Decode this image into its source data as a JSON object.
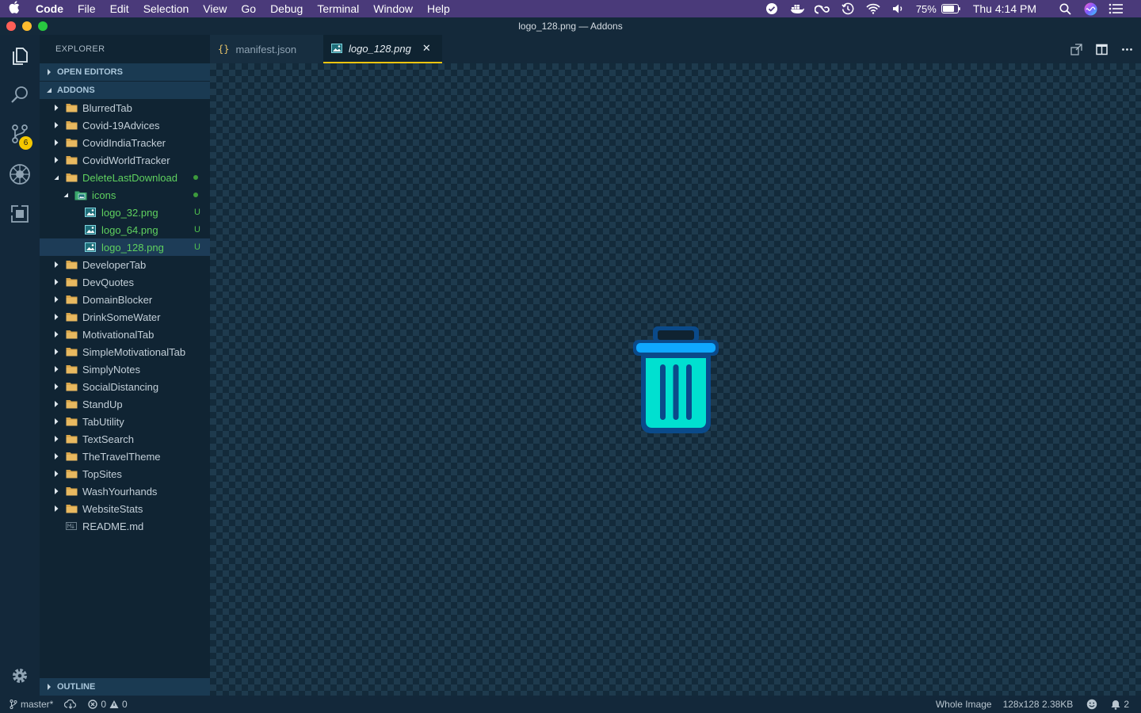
{
  "menubar": {
    "app_name": "Code",
    "items": [
      "File",
      "Edit",
      "Selection",
      "View",
      "Go",
      "Debug",
      "Terminal",
      "Window",
      "Help"
    ],
    "battery_percent": "75%",
    "clock": "Thu 4:14 PM",
    "tray_icons": [
      "reminders-icon",
      "docker-icon",
      "creative-cloud-icon",
      "time-machine-icon",
      "wifi-icon",
      "volume-icon",
      "battery-icon",
      "spotlight-icon",
      "siri-icon",
      "control-list-icon"
    ]
  },
  "window": {
    "title": "logo_128.png — Addons"
  },
  "activitybar": {
    "scm_badge": "6"
  },
  "sidebar": {
    "title": "EXPLORER",
    "open_editors_label": "OPEN EDITORS",
    "root_label": "ADDONS",
    "outline_label": "OUTLINE",
    "tree": [
      {
        "label": "BlurredTab",
        "type": "folder",
        "depth": 0,
        "expanded": false
      },
      {
        "label": "Covid-19Advices",
        "type": "folder",
        "depth": 0,
        "expanded": false
      },
      {
        "label": "CovidIndiaTracker",
        "type": "folder",
        "depth": 0,
        "expanded": false
      },
      {
        "label": "CovidWorldTracker",
        "type": "folder",
        "depth": 0,
        "expanded": false
      },
      {
        "label": "DeleteLastDownload",
        "type": "folder",
        "depth": 0,
        "expanded": true,
        "modified": true
      },
      {
        "label": "icons",
        "type": "folder",
        "depth": 1,
        "expanded": true,
        "modified": true
      },
      {
        "label": "logo_32.png",
        "type": "image",
        "depth": 2,
        "status": "U"
      },
      {
        "label": "logo_64.png",
        "type": "image",
        "depth": 2,
        "status": "U"
      },
      {
        "label": "logo_128.png",
        "type": "image",
        "depth": 2,
        "status": "U",
        "selected": true
      },
      {
        "label": "DeveloperTab",
        "type": "folder",
        "depth": 0,
        "expanded": false
      },
      {
        "label": "DevQuotes",
        "type": "folder",
        "depth": 0,
        "expanded": false
      },
      {
        "label": "DomainBlocker",
        "type": "folder",
        "depth": 0,
        "expanded": false
      },
      {
        "label": "DrinkSomeWater",
        "type": "folder",
        "depth": 0,
        "expanded": false
      },
      {
        "label": "MotivationalTab",
        "type": "folder",
        "depth": 0,
        "expanded": false
      },
      {
        "label": "SimpleMotivationalTab",
        "type": "folder",
        "depth": 0,
        "expanded": false
      },
      {
        "label": "SimplyNotes",
        "type": "folder",
        "depth": 0,
        "expanded": false
      },
      {
        "label": "SocialDistancing",
        "type": "folder",
        "depth": 0,
        "expanded": false
      },
      {
        "label": "StandUp",
        "type": "folder",
        "depth": 0,
        "expanded": false
      },
      {
        "label": "TabUtility",
        "type": "folder",
        "depth": 0,
        "expanded": false
      },
      {
        "label": "TextSearch",
        "type": "folder",
        "depth": 0,
        "expanded": false
      },
      {
        "label": "TheTravelTheme",
        "type": "folder",
        "depth": 0,
        "expanded": false
      },
      {
        "label": "TopSites",
        "type": "folder",
        "depth": 0,
        "expanded": false
      },
      {
        "label": "WashYourhands",
        "type": "folder",
        "depth": 0,
        "expanded": false
      },
      {
        "label": "WebsiteStats",
        "type": "folder",
        "depth": 0,
        "expanded": false
      },
      {
        "label": "README.md",
        "type": "markdown",
        "depth": 0
      }
    ]
  },
  "tabs": [
    {
      "label": "manifest.json",
      "icon": "json-braces-icon",
      "active": false
    },
    {
      "label": "logo_128.png",
      "icon": "image-file-icon",
      "active": true
    }
  ],
  "statusbar": {
    "branch": "master*",
    "errors": "0",
    "warnings": "0",
    "image_view": "Whole Image",
    "image_info": "128x128 2.38KB",
    "notifications": "2"
  },
  "colors": {
    "accent_tab_border": "#f1c40f",
    "git_untracked": "#5fd15f",
    "badge": "#f5c800",
    "trash_icon_fill": "#00e0d0",
    "trash_icon_outline": "#0077c8"
  }
}
